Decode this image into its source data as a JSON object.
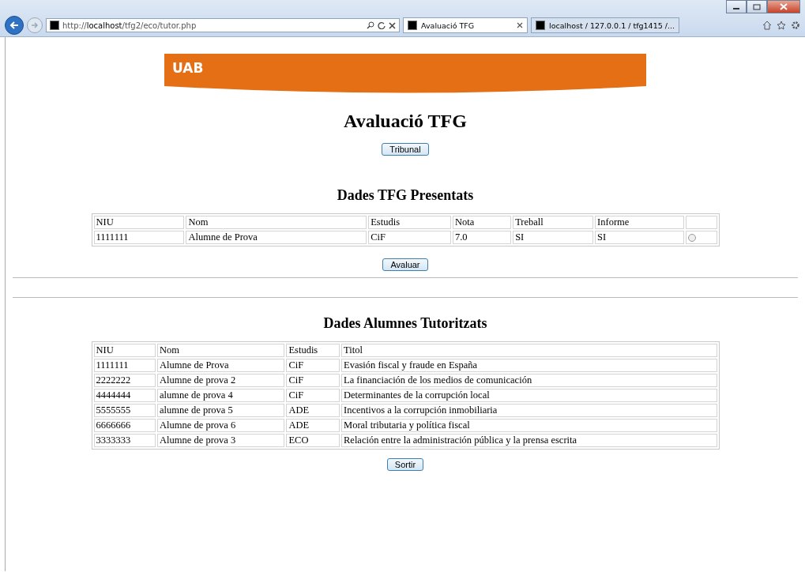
{
  "browser": {
    "address": {
      "prefix": "http://",
      "host": "localhost",
      "path": "/tfg2/eco/tutor.php"
    },
    "tabs": [
      {
        "label": "Avaluació TFG",
        "selected": true
      },
      {
        "label": "localhost / 127.0.0.1 / tfg1415 /...",
        "selected": false
      }
    ]
  },
  "banner": {
    "logo": "UAB"
  },
  "page_title": "Avaluació TFG",
  "tribunal_button": "Tribunal",
  "presented": {
    "heading": "Dades TFG Presentats",
    "columns": [
      "NIU",
      "Nom",
      "Estudis",
      "Nota",
      "Treball",
      "Informe"
    ],
    "rows": [
      {
        "cells": [
          "1111111",
          "Alumne de Prova",
          "CiF",
          "7.0",
          "SI",
          "SI"
        ],
        "selected": false
      }
    ],
    "button": "Avaluar"
  },
  "tutored": {
    "heading": "Dades Alumnes Tutoritzats",
    "columns": [
      "NIU",
      "Nom",
      "Estudis",
      "Titol"
    ],
    "rows": [
      [
        "1111111",
        "Alumne de Prova",
        "CiF",
        "Evasión fiscal y fraude en España"
      ],
      [
        "2222222",
        "Alumne de prova 2",
        "CiF",
        "La financiación de los medios de comunicación"
      ],
      [
        "4444444",
        "alumne de prova 4",
        "CiF",
        "Determinantes de la corrupción local"
      ],
      [
        "5555555",
        "alumne de prova 5",
        "ADE",
        "Incentivos a la corrupción inmobiliaria"
      ],
      [
        "6666666",
        "Alumne de prova 6",
        "ADE",
        "Moral tributaria y política fiscal"
      ],
      [
        "3333333",
        "Alumne de prova 3",
        "ECO",
        "Relación entre la administración pública y la prensa escrita"
      ]
    ],
    "button": "Sortir"
  }
}
